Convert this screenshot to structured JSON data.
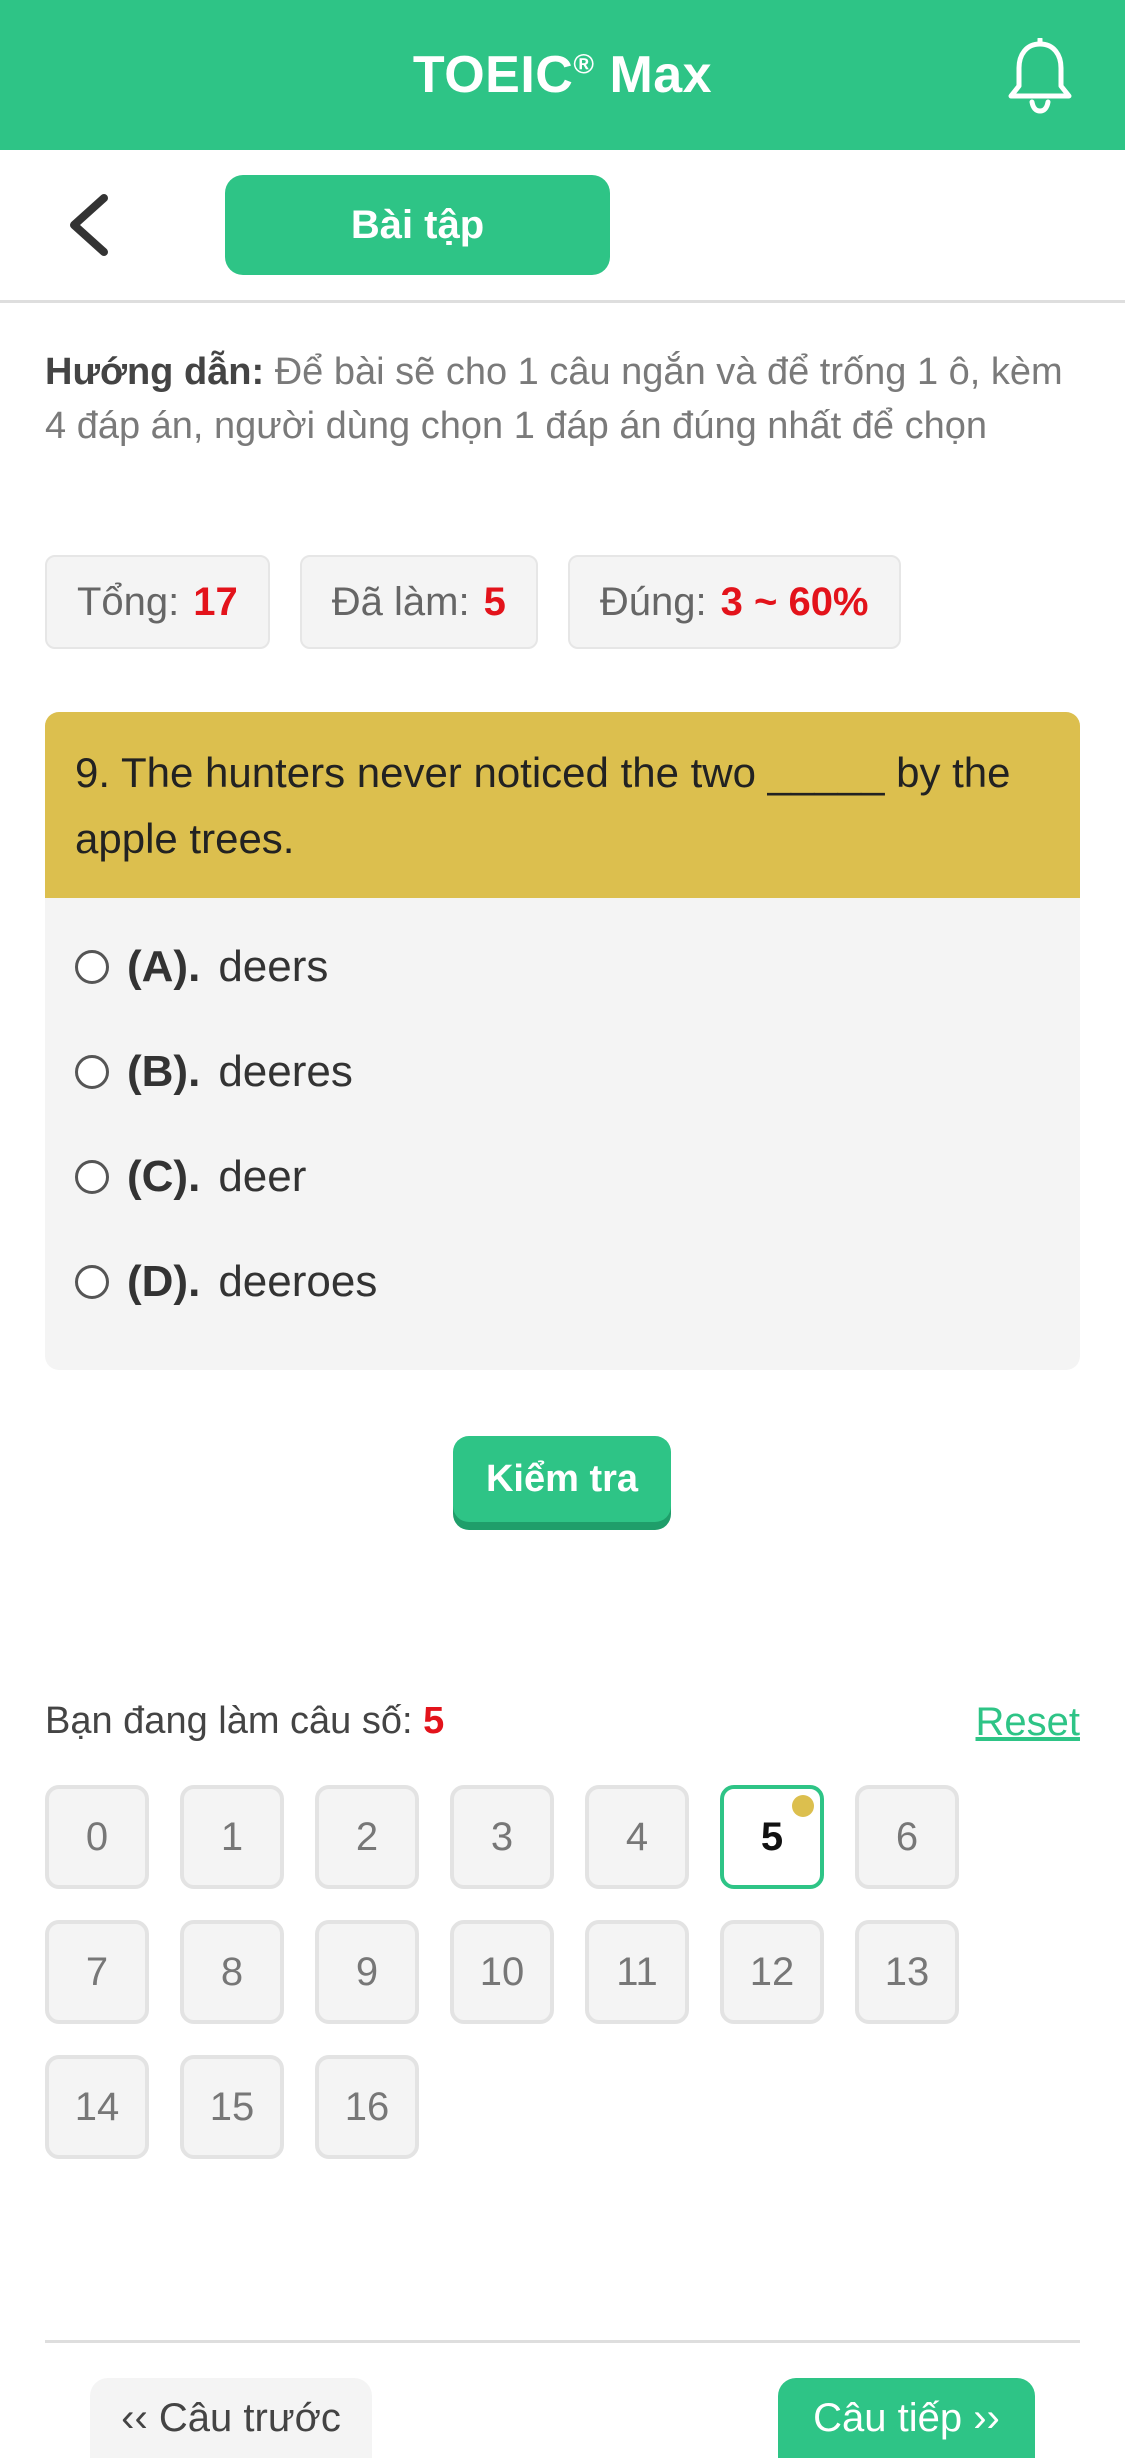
{
  "header": {
    "title": "TOEIC",
    "title_mark": "®",
    "title_suffix": " Max",
    "bell_icon": "bell-icon",
    "accent_color": "#2ec486"
  },
  "subbar": {
    "back_icon": "chevron-left-icon",
    "tab_label": "Bài tập"
  },
  "instruction": {
    "label": "Hướng dẫn:",
    "text": " Để bài sẽ cho 1 câu ngắn và để trống 1 ô, kèm 4 đáp án, người dùng chọn 1 đáp án đúng nhất để chọn"
  },
  "stats": {
    "total_label": "Tổng:",
    "total_value": "17",
    "done_label": "Đã làm:",
    "done_value": "5",
    "correct_label": "Đúng:",
    "correct_value": "3 ~ 60%"
  },
  "question": {
    "text": "9. The hunters never noticed the two _____ by the apple trees.",
    "options": [
      {
        "letter": "(A).",
        "text": "deers"
      },
      {
        "letter": "(B).",
        "text": "deeres"
      },
      {
        "letter": "(C).",
        "text": "deer"
      },
      {
        "letter": "(D).",
        "text": "deeroes"
      }
    ],
    "check_label": "Kiểm tra",
    "header_color": "#dcbf4e"
  },
  "progress": {
    "current_label": "Bạn đang làm câu số:",
    "current_value": "5",
    "reset_label": "Reset",
    "numbers": [
      "0",
      "1",
      "2",
      "3",
      "4",
      "5",
      "6",
      "7",
      "8",
      "9",
      "10",
      "11",
      "12",
      "13",
      "14",
      "15",
      "16"
    ],
    "active_index": 5
  },
  "footer": {
    "prev_label": "‹‹ Câu trước",
    "next_label": "Câu tiếp ››"
  }
}
